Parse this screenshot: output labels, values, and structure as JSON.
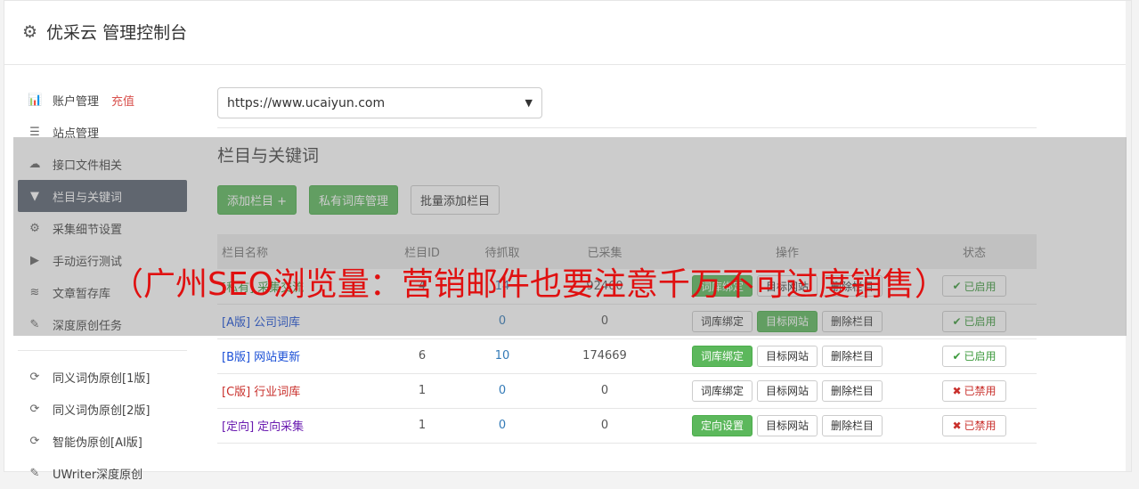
{
  "header": {
    "title": "优采云 管理控制台",
    "icon": "gear-icon"
  },
  "sidebar": {
    "items": [
      {
        "label": "账户管理",
        "extra": "充值",
        "icon": "bar-chart-icon"
      },
      {
        "label": "站点管理",
        "icon": "server-icon"
      },
      {
        "label": "接口文件相关",
        "icon": "cloud-upload-icon"
      },
      {
        "label": "栏目与关键词",
        "icon": "filter-icon",
        "active": true
      },
      {
        "label": "采集细节设置",
        "icon": "gears-icon"
      },
      {
        "label": "手动运行测试",
        "icon": "play-circle-icon"
      },
      {
        "label": "文章暂存库",
        "icon": "database-icon"
      },
      {
        "label": "深度原创任务",
        "icon": "edit-icon"
      }
    ],
    "items2": [
      {
        "label": "同义词伪原创[1版]",
        "icon": "refresh-icon"
      },
      {
        "label": "同义词伪原创[2版]",
        "icon": "refresh-icon"
      },
      {
        "label": "智能伪原创[AI版]",
        "icon": "refresh-icon"
      },
      {
        "label": "UWriter深度原创",
        "icon": "edit-icon"
      }
    ]
  },
  "main": {
    "site_select": "https://www.ucaiyun.com",
    "section_title": "栏目与关键词",
    "buttons": {
      "add": "添加栏目 +",
      "private": "私有词库管理",
      "batch": "批量添加栏目"
    },
    "table": {
      "headers": [
        "栏目名称",
        "栏目ID",
        "待抓取",
        "已采集",
        "操作",
        "状态"
      ],
      "rows": [
        {
          "tag": "[私有]",
          "name": "采集交流",
          "color": "green",
          "id": "4",
          "pending": "14",
          "collected": "92460",
          "op1": "词库绑定",
          "op1_green": true,
          "op2": "目标网站",
          "op3": "删除栏目",
          "status": "已启用",
          "on": true
        },
        {
          "tag": "[A版]",
          "name": "公司词库",
          "color": "blue",
          "id": "",
          "pending": "0",
          "collected": "0",
          "op1": "词库绑定",
          "op1_green": false,
          "op2": "目标网站",
          "op2_green": true,
          "op3": "删除栏目",
          "status": "已启用",
          "on": true
        },
        {
          "tag": "[B版]",
          "name": "网站更新",
          "color": "blue",
          "id": "6",
          "pending": "10",
          "collected": "174669",
          "op1": "词库绑定",
          "op1_green": true,
          "op2": "目标网站",
          "op3": "删除栏目",
          "status": "已启用",
          "on": true
        },
        {
          "tag": "[C版]",
          "name": "行业词库",
          "color": "red",
          "id": "1",
          "pending": "0",
          "collected": "0",
          "op1": "词库绑定",
          "op1_green": false,
          "op2": "目标网站",
          "op3": "删除栏目",
          "status": "已禁用",
          "on": false
        },
        {
          "tag": "[定向]",
          "name": "定向采集",
          "color": "purple",
          "id": "1",
          "pending": "0",
          "collected": "0",
          "op1": "定向设置",
          "op1_green": true,
          "op2": "目标网站",
          "op3": "删除栏目",
          "status": "已禁用",
          "on": false
        }
      ]
    }
  },
  "overlay_caption": "（广州SEO浏览量：营销邮件也要注意千万不可过度销售）",
  "colors": {
    "accent_green": "#5cb85c",
    "sidebar_active": "#5a6370",
    "caption_red": "#e01010",
    "link_blue": "#337ab7"
  }
}
